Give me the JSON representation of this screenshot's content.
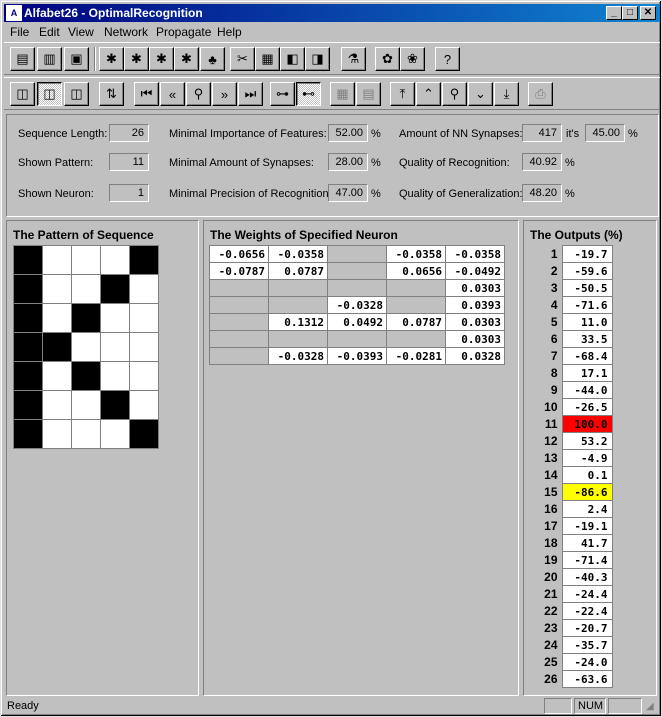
{
  "window": {
    "title": "Alfabet26 - OptimalRecognition",
    "app_icon": "app-icon",
    "min": "_",
    "max": "□",
    "close": "✕"
  },
  "menu": [
    "File",
    "Edit",
    "View",
    "Network",
    "Propagate",
    "Help"
  ],
  "toolbar1": [
    "new-icon",
    "open-icon",
    "save-icon",
    "sequence-a-icon",
    "sequence-b-icon",
    "sequence-c-icon",
    "sequence-d-icon",
    "apple-icon",
    "cut-icon",
    "network-icon",
    "load-icon",
    "store-icon",
    "wizard-icon",
    "teach-icon",
    "recall-icon",
    "help-icon"
  ],
  "toolbar2": [
    "view-left-icon",
    "view-center-icon",
    "view-right-icon",
    "swap-icon",
    "first-icon",
    "previous-icon",
    "find-icon",
    "next-icon",
    "last-icon",
    "neuron-left-icon",
    "neuron-right-icon",
    "grid-icon",
    "list-icon",
    "top-icon",
    "up-icon",
    "find-neuron-icon",
    "down-icon",
    "bottom-icon",
    "print-icon"
  ],
  "info": {
    "seq_len_label": "Sequence Length:",
    "seq_len": "26",
    "shown_pattern_label": "Shown Pattern:",
    "shown_pattern": "11",
    "shown_neuron_label": "Shown Neuron:",
    "shown_neuron": "1",
    "min_imp_label": "Minimal Importance of Features:",
    "min_imp": "52.00",
    "pct": "%",
    "min_syn_label": "Minimal Amount of Synapses:",
    "min_syn": "28.00",
    "min_prec_label": "Minimal Precision of Recognition:",
    "min_prec": "47.00",
    "amount_label": "Amount of NN Synapses:",
    "amount": "417",
    "its_label": "it's",
    "its": "45.00",
    "quality_rec_label": "Quality of Recognition:",
    "quality_rec": "40.92",
    "quality_gen_label": "Quality of Generalization:",
    "quality_gen": "48.20"
  },
  "pattern": {
    "title": "The Pattern of Sequence",
    "grid": [
      [
        1,
        0,
        0,
        0,
        1
      ],
      [
        1,
        0,
        0,
        1,
        0
      ],
      [
        1,
        0,
        1,
        0,
        0
      ],
      [
        1,
        1,
        0,
        0,
        0
      ],
      [
        1,
        0,
        1,
        0,
        0
      ],
      [
        1,
        0,
        0,
        1,
        0
      ],
      [
        1,
        0,
        0,
        0,
        1
      ]
    ]
  },
  "weights": {
    "title": "The Weights of Specified Neuron",
    "rows": [
      [
        "-0.0656",
        "-0.0358",
        "",
        "-0.0358",
        "-0.0358"
      ],
      [
        "-0.0787",
        "0.0787",
        "",
        "0.0656",
        "-0.0492"
      ],
      [
        "",
        "",
        "",
        "",
        "0.0303"
      ],
      [
        "",
        "",
        "-0.0328",
        "",
        "0.0393"
      ],
      [
        "",
        "0.1312",
        "0.0492",
        "0.0787",
        "0.0303"
      ],
      [
        "",
        "",
        "",
        "",
        "0.0303"
      ],
      [
        "",
        "-0.0328",
        "-0.0393",
        "-0.0281",
        "0.0328"
      ]
    ]
  },
  "outputs": {
    "title": "The Outputs (%)",
    "items": [
      {
        "n": "1",
        "v": "-19.7"
      },
      {
        "n": "2",
        "v": "-59.6"
      },
      {
        "n": "3",
        "v": "-50.5"
      },
      {
        "n": "4",
        "v": "-71.6"
      },
      {
        "n": "5",
        "v": "11.0"
      },
      {
        "n": "6",
        "v": "33.5"
      },
      {
        "n": "7",
        "v": "-68.4"
      },
      {
        "n": "8",
        "v": "17.1"
      },
      {
        "n": "9",
        "v": "-44.0"
      },
      {
        "n": "10",
        "v": "-26.5"
      },
      {
        "n": "11",
        "v": "100.0",
        "hl": "red"
      },
      {
        "n": "12",
        "v": "53.2"
      },
      {
        "n": "13",
        "v": "-4.9"
      },
      {
        "n": "14",
        "v": "0.1"
      },
      {
        "n": "15",
        "v": "-86.6",
        "hl": "yellow"
      },
      {
        "n": "16",
        "v": "2.4"
      },
      {
        "n": "17",
        "v": "-19.1"
      },
      {
        "n": "18",
        "v": "41.7"
      },
      {
        "n": "19",
        "v": "-71.4"
      },
      {
        "n": "20",
        "v": "-40.3"
      },
      {
        "n": "21",
        "v": "-24.4"
      },
      {
        "n": "22",
        "v": "-22.4"
      },
      {
        "n": "23",
        "v": "-20.7"
      },
      {
        "n": "24",
        "v": "-35.7"
      },
      {
        "n": "25",
        "v": "-24.0"
      },
      {
        "n": "26",
        "v": "-63.6"
      }
    ]
  },
  "status": {
    "text": "Ready",
    "num": "NUM"
  },
  "colors": {
    "highlight_max": "#ff0000",
    "highlight_min": "#ffff00",
    "titlebar": "#000080"
  }
}
